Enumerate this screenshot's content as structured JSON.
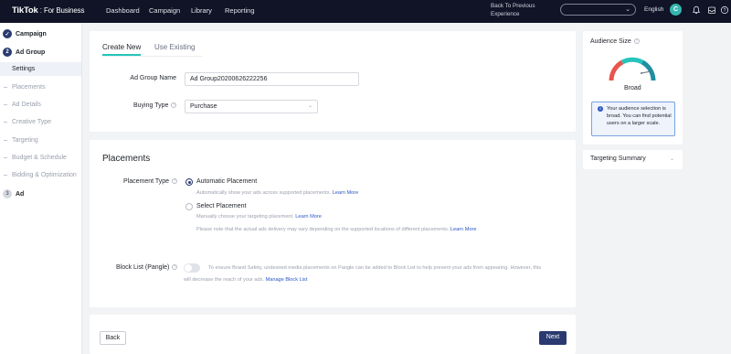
{
  "topbar": {
    "logo_brand": "TikTok",
    "logo_sep": ":",
    "logo_suffix": "For Business",
    "nav": [
      "Dashboard",
      "Campaign",
      "Library",
      "Reporting"
    ],
    "back_to_previous": "Back To Previous Experience",
    "language": "English",
    "avatar_letter": "C"
  },
  "sidebar": {
    "steps": [
      {
        "number": "✓",
        "label": "Campaign",
        "state": "done"
      },
      {
        "number": "2",
        "label": "Ad Group",
        "state": "active"
      },
      {
        "number": "3",
        "label": "Ad",
        "state": "todo"
      }
    ],
    "active_sub": "Settings",
    "subs": [
      "Placements",
      "Ad Details",
      "Creative Type",
      "Targeting",
      "Budget & Schedule",
      "Bidding & Optimization"
    ]
  },
  "settings": {
    "tabs": [
      "Create New",
      "Use Existing"
    ],
    "ad_group_name_label": "Ad Group Name",
    "ad_group_name_value": "Ad Group20200626222256",
    "buying_type_label": "Buying Type",
    "buying_type_value": "Purchase"
  },
  "placements": {
    "title": "Placements",
    "placement_type_label": "Placement Type",
    "automatic_label": "Automatic Placement",
    "automatic_help": "Automatically show your ads across supported placements.",
    "automatic_link": "Learn More",
    "select_label": "Select Placement",
    "select_help": "Manually choose your targeting placement.",
    "select_link": "Learn More",
    "note": "Please note that the actual ads delivery may vary depending on the supported locations of different placements.",
    "note_link": "Learn More",
    "block_list_label": "Block List (Pangle)",
    "block_list_help_1": "To ensure Brand Safety, undesired media placements on Pangle can be added to Block List to help prevent your ads from appearing. However, this",
    "block_list_help_2": "will decrease the reach of your ads.",
    "block_list_link": "Manage Block List",
    "block_list_enabled": false
  },
  "footer": {
    "back_label": "Back",
    "next_label": "Next"
  },
  "right_panel": {
    "audience_title": "Audience Size",
    "gauge_value_label": "Broad",
    "info_text": "Your audience selection is broad. You can find potential users on a larger scale.",
    "targeting_summary": "Targeting Summary"
  },
  "colors": {
    "topbar": "#101426",
    "accent_teal": "#25c4bc",
    "primary_navy": "#2a3a70",
    "link_blue": "#2a56c6"
  }
}
